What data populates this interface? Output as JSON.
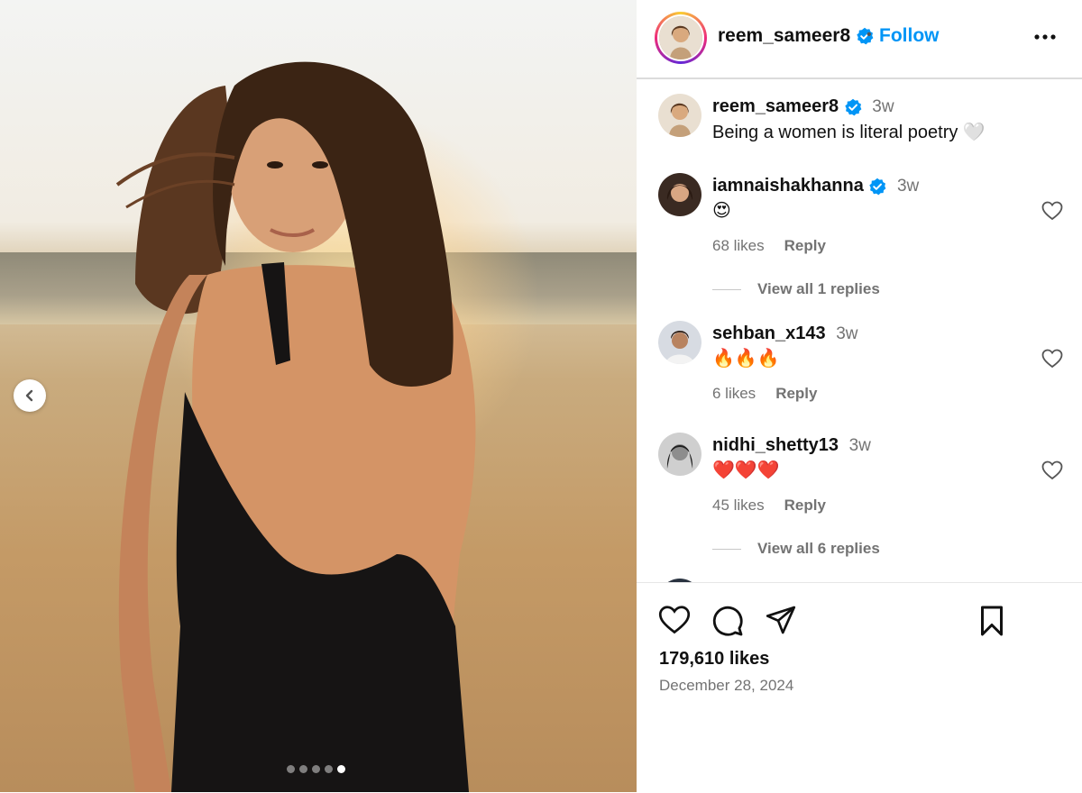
{
  "post": {
    "author": "reem_sameer8",
    "follow_label": "Follow",
    "separator": "•",
    "carousel": {
      "total": 5,
      "active_index": 4
    }
  },
  "caption": {
    "username": "reem_sameer8",
    "time": "3w",
    "text": "Being a women is literal poetry 🤍"
  },
  "comments": [
    {
      "username": "iamnaishakhanna",
      "verified": true,
      "time": "3w",
      "text": "😍",
      "likes": "68 likes",
      "reply": "Reply",
      "view_replies": "View all 1 replies"
    },
    {
      "username": "sehban_x143",
      "verified": false,
      "time": "3w",
      "text": "🔥🔥🔥",
      "likes": "6 likes",
      "reply": "Reply",
      "view_replies": ""
    },
    {
      "username": "nidhi_shetty13",
      "verified": false,
      "time": "3w",
      "text": "❤️❤️❤️",
      "likes": "45 likes",
      "reply": "Reply",
      "view_replies": "View all 6 replies"
    }
  ],
  "footer": {
    "likes": "179,610 likes",
    "date": "December 28, 2024"
  },
  "colors": {
    "accent": "#0095f6",
    "verified": "#0095f6",
    "muted": "#737373"
  }
}
